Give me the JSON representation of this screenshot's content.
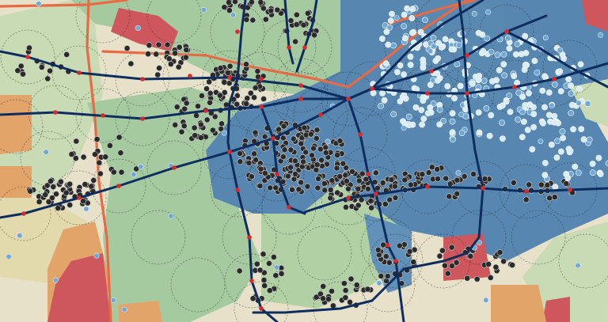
{
  "map": {
    "type": "transit-accessibility overlay map",
    "labels": [],
    "colors": {
      "basemap": "#e6e1c8",
      "zone_blue": "#3f78ad",
      "zone_green": "#9cc79a",
      "zone_lightgreen": "#c3dbb1",
      "zone_tan": "#e2d9a8",
      "zone_orange": "#e39a5a",
      "zone_red": "#c9404a",
      "transit_line": "#0d2d5e",
      "highway": "#e86a45",
      "station": "#d92a2a",
      "buffer_ring": "#222222",
      "point_dark": "#2a2a2a",
      "point_light": "#d7ecf7",
      "point_blue": "#6fa7d6"
    },
    "legend": null
  }
}
